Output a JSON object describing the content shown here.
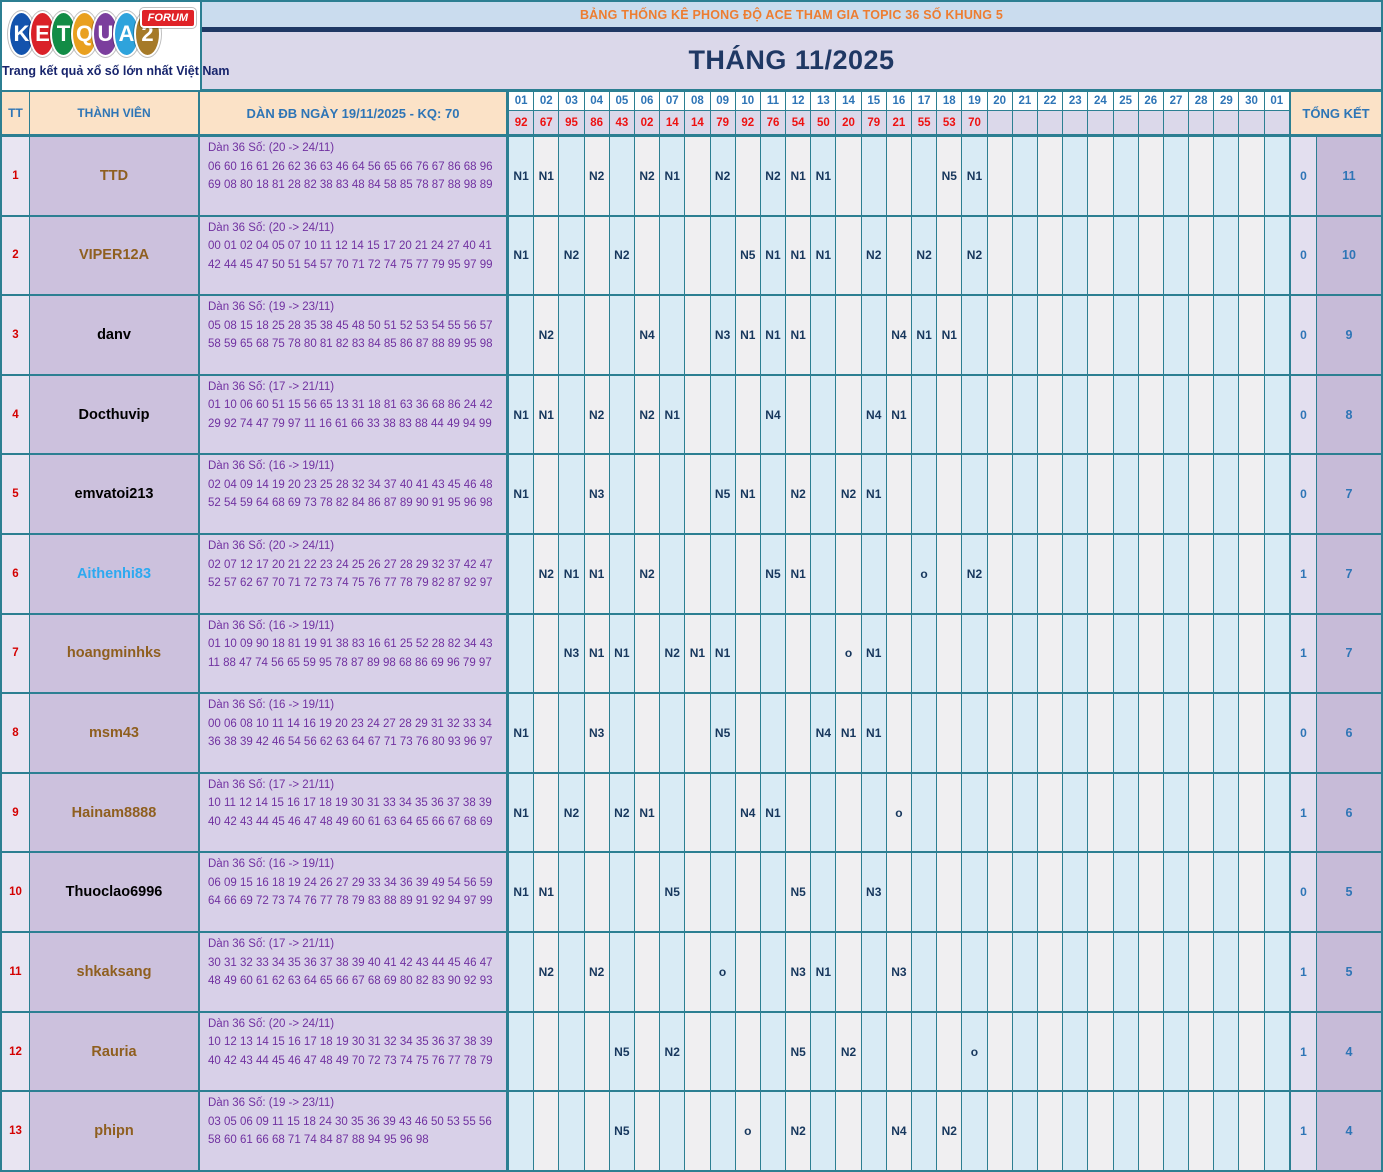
{
  "logo": {
    "letters": [
      "K",
      "E",
      "T",
      "Q",
      "U",
      "A",
      "2"
    ],
    "letter_colors": [
      "#1353ad",
      "#da2128",
      "#128c46",
      "#e9a01f",
      "#7b3e9d",
      "#2ea3dc",
      "#a67a28"
    ],
    "badge": "FORUM",
    "tagline": "Trang kết quả xổ số lớn nhất Việt Nam"
  },
  "banner": {
    "title": "BẢNG THỐNG KÊ PHONG ĐỘ ACE THAM GIA TOPIC 36 SỐ KHUNG 5"
  },
  "month_title": "THÁNG 11/2025",
  "colors": {
    "grid_teal": "#2C7F92",
    "header_peach": "#FBE2C7",
    "header_blue_text": "#2E75B6",
    "banner_bg": "#CADCEE",
    "banner_orange_text": "#ED7D31",
    "navy": "#1F3864",
    "lavender": "#DBD8EA",
    "result_red": "#EE1111",
    "tt_red": "#D40000",
    "member_bg": "#CCC1DD",
    "dan_bg": "#D8D0E8",
    "dan_purple_text": "#7030A0",
    "stripe_blue": "#D9EBF5",
    "stripe_white": "#F0EFF1",
    "mark_navy_text": "#17375D",
    "total_left_bg": "#E3DFEF",
    "total_right_bg": "#C7BBD8"
  },
  "table": {
    "headers": {
      "tt": "TT",
      "member": "THÀNH VIÊN",
      "dan": "DÀN ĐB NGÀY 19/11/2025 - KQ: 70",
      "total": "TỔNG KẾT"
    },
    "days": [
      "01",
      "02",
      "03",
      "04",
      "05",
      "06",
      "07",
      "08",
      "09",
      "10",
      "11",
      "12",
      "13",
      "14",
      "15",
      "16",
      "17",
      "18",
      "19",
      "20",
      "21",
      "22",
      "23",
      "24",
      "25",
      "26",
      "27",
      "28",
      "29",
      "30",
      "01"
    ],
    "results": [
      "92",
      "67",
      "95",
      "86",
      "43",
      "02",
      "14",
      "14",
      "79",
      "92",
      "76",
      "54",
      "50",
      "20",
      "79",
      "21",
      "55",
      "53",
      "70",
      "",
      "",
      "",
      "",
      "",
      "",
      "",
      "",
      "",
      "",
      "",
      ""
    ],
    "rows": [
      {
        "tt": "1",
        "name": "TTD",
        "name_color": "#8f5f1f",
        "dan_title": "Dàn 36 Số: (20 -> 24/11)",
        "dan_numbers": "06 60 16 61 26 62 36 63 46 64 56 65 66 76 67 86 68 96 69 08 80 18 81 28 82 38 83 48 84 58 85 78 87 88 98 89",
        "marks": {
          "0": "N1",
          "1": "N1",
          "3": "N2",
          "5": "N2",
          "6": "N1",
          "8": "N2",
          "10": "N2",
          "11": "N1",
          "12": "N1",
          "17": "N5",
          "18": "N1"
        },
        "totals": [
          "0",
          "11"
        ]
      },
      {
        "tt": "2",
        "name": "VIPER12A",
        "name_color": "#8f5f1f",
        "dan_title": "Dàn 36 Số: (20 -> 24/11)",
        "dan_numbers": "00 01 02 04 05 07 10 11 12 14 15 17 20 21 24 27 40 41 42 44 45 47 50 51 54 57 70 71 72 74 75 77 79 95 97 99",
        "marks": {
          "0": "N1",
          "2": "N2",
          "4": "N2",
          "9": "N5",
          "10": "N1",
          "11": "N1",
          "12": "N1",
          "14": "N2",
          "16": "N2",
          "18": "N2"
        },
        "totals": [
          "0",
          "10"
        ]
      },
      {
        "tt": "3",
        "name": "danv",
        "name_color": "#000000",
        "dan_title": "Dàn 36 Số: (19 -> 23/11)",
        "dan_numbers": "05 08 15 18 25 28 35 38 45 48 50 51 52 53 54 55 56 57 58 59 65 68 75 78 80 81 82 83 84 85 86 87 88 89 95 98",
        "marks": {
          "1": "N2",
          "5": "N4",
          "8": "N3",
          "9": "N1",
          "10": "N1",
          "11": "N1",
          "15": "N4",
          "16": "N1",
          "17": "N1"
        },
        "totals": [
          "0",
          "9"
        ]
      },
      {
        "tt": "4",
        "name": "Docthuvip",
        "name_color": "#000000",
        "dan_title": "Dàn 36 Số: (17 -> 21/11)",
        "dan_numbers": "01 10 06 60 51 15 56 65 13 31 18 81 63 36 68 86 24 42 29 92 74 47 79 97 11 16 61 66 33 38 83 88 44 49 94 99",
        "marks": {
          "0": "N1",
          "1": "N1",
          "3": "N2",
          "5": "N2",
          "6": "N1",
          "10": "N4",
          "14": "N4",
          "15": "N1"
        },
        "totals": [
          "0",
          "8"
        ]
      },
      {
        "tt": "5",
        "name": "emvatoi213",
        "name_color": "#000000",
        "dan_title": "Dàn 36 Số: (16 -> 19/11)",
        "dan_numbers": "02 04 09 14 19 20 23 25 28 32 34 37 40 41 43 45 46 48 52 54 59 64 68 69 73 78 82 84 86 87 89 90 91 95 96 98",
        "marks": {
          "0": "N1",
          "3": "N3",
          "8": "N5",
          "9": "N1",
          "11": "N2",
          "13": "N2",
          "14": "N1"
        },
        "totals": [
          "0",
          "7"
        ]
      },
      {
        "tt": "6",
        "name": "Aithenhi83",
        "name_color": "#2da9f0",
        "dan_title": "Dàn 36 Số: (20 -> 24/11)",
        "dan_numbers": "02 07 12 17 20 21 22 23 24 25 26 27 28 29 32 37 42 47 52 57 62 67 70 71 72 73 74 75 76 77 78 79 82 87 92 97",
        "marks": {
          "1": "N2",
          "2": "N1",
          "3": "N1",
          "5": "N2",
          "10": "N5",
          "11": "N1",
          "16": "o",
          "18": "N2"
        },
        "totals": [
          "1",
          "7"
        ]
      },
      {
        "tt": "7",
        "name": "hoangminhks",
        "name_color": "#8f5f1f",
        "dan_title": "Dàn 36 Số: (16 -> 19/11)",
        "dan_numbers": "01 10 09 90 18 81 19 91 38 83 16 61 25 52 28 82 34 43 11 88 47 74 56 65 59 95 78 87 89 98 68 86 69 96 79 97",
        "marks": {
          "2": "N3",
          "3": "N1",
          "4": "N1",
          "6": "N2",
          "7": "N1",
          "8": "N1",
          "13": "o",
          "14": "N1"
        },
        "totals": [
          "1",
          "7"
        ]
      },
      {
        "tt": "8",
        "name": "msm43",
        "name_color": "#8f5f1f",
        "dan_title": "Dàn 36 Số: (16 -> 19/11)",
        "dan_numbers": "00 06 08 10 11 14 16 19 20 23 24 27 28 29 31 32 33 34 36 38 39 42 46 54 56 62 63 64 67 71 73 76 80 93 96 97",
        "marks": {
          "0": "N1",
          "3": "N3",
          "8": "N5",
          "12": "N4",
          "13": "N1",
          "14": "N1"
        },
        "totals": [
          "0",
          "6"
        ]
      },
      {
        "tt": "9",
        "name": "Hainam8888",
        "name_color": "#8f5f1f",
        "dan_title": "Dàn 36 Số: (17 -> 21/11)",
        "dan_numbers": "10 11 12 14 15 16 17 18 19 30 31 33 34 35 36 37 38 39 40 42 43 44 45 46 47 48 49 60 61 63 64 65 66 67 68 69",
        "marks": {
          "0": "N1",
          "2": "N2",
          "4": "N2",
          "5": "N1",
          "9": "N4",
          "10": "N1",
          "15": "o"
        },
        "totals": [
          "1",
          "6"
        ]
      },
      {
        "tt": "10",
        "name": "Thuoclao6996",
        "name_color": "#000000",
        "dan_title": "Dàn 36 Số: (16 -> 19/11)",
        "dan_numbers": "06 09 15 16 18 19 24 26 27 29 33 34 36 39 49 54 56 59 64 66 69 72 73 74 76 77 78 79 83 88 89 91 92 94 97 99",
        "marks": {
          "0": "N1",
          "1": "N1",
          "6": "N5",
          "11": "N5",
          "14": "N3"
        },
        "totals": [
          "0",
          "5"
        ]
      },
      {
        "tt": "11",
        "name": "shkaksang",
        "name_color": "#8f5f1f",
        "dan_title": "Dàn 36 Số: (17 -> 21/11)",
        "dan_numbers": "30 31 32 33 34 35 36 37 38 39 40 41 42 43 44 45 46 47 48 49 60 61 62 63 64 65 66 67 68 69 80 82 83 90 92 93",
        "marks": {
          "1": "N2",
          "3": "N2",
          "8": "o",
          "11": "N3",
          "12": "N1",
          "15": "N3"
        },
        "totals": [
          "1",
          "5"
        ]
      },
      {
        "tt": "12",
        "name": "Rauria",
        "name_color": "#8f5f1f",
        "dan_title": "Dàn 36 Số: (20 -> 24/11)",
        "dan_numbers": "10 12 13 14 15 16 17 18 19 30 31 32 34 35 36 37 38 39 40 42 43 44 45 46 47 48 49 70 72 73 74 75 76 77 78 79",
        "marks": {
          "4": "N5",
          "6": "N2",
          "11": "N5",
          "13": "N2",
          "18": "o"
        },
        "totals": [
          "1",
          "4"
        ]
      },
      {
        "tt": "13",
        "name": "phipn",
        "name_color": "#8f5f1f",
        "dan_title": "Dàn 36 Số: (19 -> 23/11)",
        "dan_numbers": "03 05 06 09 11 15 18 24 30 35 36 39 43 46 50 53 55 56 58 60 61 66 68 71 74 84 87 88 94 95 96 98",
        "marks": {
          "4": "N5",
          "9": "o",
          "11": "N2",
          "15": "N4",
          "17": "N2"
        },
        "totals": [
          "1",
          "4"
        ]
      }
    ]
  }
}
